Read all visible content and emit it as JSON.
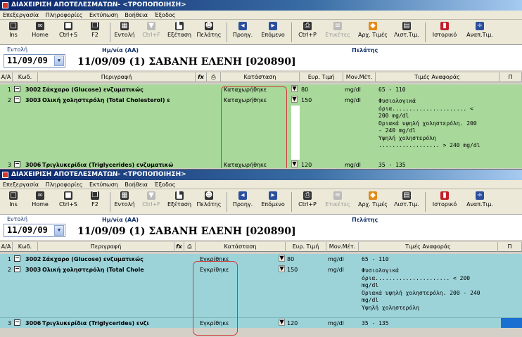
{
  "window1": {
    "title": "ΔΙΑΧΕΙΡΙΣΗ ΑΠΟΤΕΛΕΣΜΑΤΩΝ- <ΤΡΟΠΟΠΟΙΗΣΗ>",
    "menu": [
      "Επεξεργασία",
      "Πληροφορίες",
      "Εκτύπωση",
      "Βοήθεια",
      "Έξοδος"
    ],
    "toolbar": [
      {
        "label": "Ins",
        "icon": "new-doc-icon",
        "enabled": true
      },
      {
        "label": "Home",
        "icon": "glasses-icon",
        "enabled": true
      },
      {
        "label": "Ctrl+S",
        "icon": "save-icon",
        "enabled": true
      },
      {
        "label": "F2",
        "icon": "copy-icon",
        "enabled": true
      },
      {
        "label": "Εντολή",
        "icon": "order-icon",
        "enabled": true
      },
      {
        "label": "Ctrl+F",
        "icon": "filter-icon",
        "enabled": false
      },
      {
        "label": "Εξέταση",
        "icon": "exam-icon",
        "enabled": true
      },
      {
        "label": "Πελάτης",
        "icon": "customer-icon",
        "enabled": true
      },
      {
        "label": "Προηγ.",
        "icon": "previous-icon",
        "enabled": true
      },
      {
        "label": "Επόμενο",
        "icon": "next-icon",
        "enabled": true
      },
      {
        "label": "Ctrl+P",
        "icon": "print-icon",
        "enabled": true
      },
      {
        "label": "Ετικέτες",
        "icon": "labels-icon",
        "enabled": false
      },
      {
        "label": "Αρχ. Τιμές",
        "icon": "initial-values-icon",
        "enabled": true
      },
      {
        "label": "Λιστ.Τιμ.",
        "icon": "price-list-icon",
        "enabled": true
      },
      {
        "label": "Ιστορικό",
        "icon": "history-icon",
        "enabled": true
      },
      {
        "label": "Αναπ.Τιμ.",
        "icon": "split-values-icon",
        "enabled": true
      }
    ],
    "order_label": "Εντολή",
    "order_date": "11/09/09",
    "date_label": "Ημ/νία (ΑΑ)",
    "customer_label": "Πελάτης",
    "patient_line": "11/09/09 (1)  ΣΑΒΑΝΗ ΕΛΕΝΗ [020890]",
    "columns": [
      "Α/Α",
      "Κωδ.",
      "Περιγραφή",
      "fx",
      "print",
      "Κατάσταση",
      "Ευρ. Τιμή",
      "Μον.Μέτ.",
      "Τιμές Αναφοράς",
      "Π"
    ],
    "rows": [
      {
        "n": "1",
        "code": "3002",
        "desc": "Σάκχαρο (Glucose) ενζυματικώς",
        "status": "Καταχωρήθηκε",
        "value": "80",
        "unit": "mg/dl",
        "ref": "65 - 110"
      },
      {
        "n": "2",
        "code": "3003",
        "desc": "Ολική χοληστερόλη (Total Cholesterol) ε",
        "status": "Καταχωρήθηκε",
        "value": "150",
        "unit": "mg/dl",
        "ref": "Φυσιολογικά\nόρια...................... <\n200 mg/dl\nΟριακά υψηλή χοληστερόλη. 200\n- 240 mg/dl\nΥψηλή χοληστερόλη\n.................. > 240 mg/dl"
      },
      {
        "n": "3",
        "code": "3006",
        "desc": "Τριγλυκερίδια (Triglycerides) ενζυματικώ",
        "status": "Καταχωρήθηκε",
        "value": "120",
        "unit": "mg/dl",
        "ref": "35 - 135"
      }
    ]
  },
  "window2": {
    "title": "ΔΙΑΧΕΙΡΙΣΗ ΑΠΟΤΕΛΕΣΜΑΤΩΝ- <ΤΡΟΠΟΠΟΙΗΣΗ>",
    "menu": [
      "Επεξεργασία",
      "Πληροφορίες",
      "Εκτύπωση",
      "Βοήθεια",
      "Έξοδος"
    ],
    "toolbar": [
      {
        "label": "Ins",
        "icon": "new-doc-icon",
        "enabled": true
      },
      {
        "label": "Home",
        "icon": "glasses-icon",
        "enabled": true
      },
      {
        "label": "Ctrl+S",
        "icon": "save-icon",
        "enabled": true
      },
      {
        "label": "F2",
        "icon": "copy-icon",
        "enabled": true
      },
      {
        "label": "Εντολή",
        "icon": "order-icon",
        "enabled": true
      },
      {
        "label": "Ctrl+F",
        "icon": "filter-icon",
        "enabled": false
      },
      {
        "label": "Εξέταση",
        "icon": "exam-icon",
        "enabled": true
      },
      {
        "label": "Πελάτης",
        "icon": "customer-icon",
        "enabled": true
      },
      {
        "label": "Προηγ.",
        "icon": "previous-icon",
        "enabled": true
      },
      {
        "label": "Επόμενο",
        "icon": "next-icon",
        "enabled": true
      },
      {
        "label": "Ctrl+P",
        "icon": "print-icon",
        "enabled": true
      },
      {
        "label": "Ετικέτες",
        "icon": "labels-icon",
        "enabled": false
      },
      {
        "label": "Αρχ. Τιμές",
        "icon": "initial-values-icon",
        "enabled": true
      },
      {
        "label": "Λιστ.Τιμ.",
        "icon": "price-list-icon",
        "enabled": true
      },
      {
        "label": "Ιστορικό",
        "icon": "history-icon",
        "enabled": true
      },
      {
        "label": "Αναπ.Τιμ.",
        "icon": "split-values-icon",
        "enabled": true
      }
    ],
    "order_label": "Εντολή",
    "order_date": "11/09/09",
    "date_label": "Ημ/νία (ΑΑ)",
    "customer_label": "Πελάτης",
    "patient_line": "11/09/09 (1)  ΣΑΒΑΝΗ ΕΛΕΝΗ [020890]",
    "columns": [
      "Α/Α",
      "Κωδ.",
      "Περιγραφή",
      "fx",
      "print",
      "Κατάσταση",
      "Ευρ. Τιμή",
      "Μον.Μέτ.",
      "Τιμές Αναφοράς",
      "Π"
    ],
    "rows": [
      {
        "n": "1",
        "code": "3002",
        "desc": "Σάκχαρο (Glucose) ενζυματικώς",
        "status": "Εγκρίθηκε",
        "value": "80",
        "unit": "mg/dl",
        "ref": "65 - 110"
      },
      {
        "n": "2",
        "code": "3003",
        "desc": "Ολική χοληστερόλη (Total Chole",
        "status": "Εγκρίθηκε",
        "value": "150",
        "unit": "mg/dl",
        "ref": "Φυσιολογικά\nόρια...................... < 200\nmg/dl\nΟριακά υψηλή χοληστερόλη. 200 - 240\nmg/dl\nΥψηλή χοληστερόλη"
      },
      {
        "n": "3",
        "code": "3006",
        "desc": "Τριγλυκερίδια (Triglycerides) ενζι",
        "status": "Εγκρίθηκε",
        "value": "120",
        "unit": "mg/dl",
        "ref": "35 - 135"
      }
    ]
  }
}
